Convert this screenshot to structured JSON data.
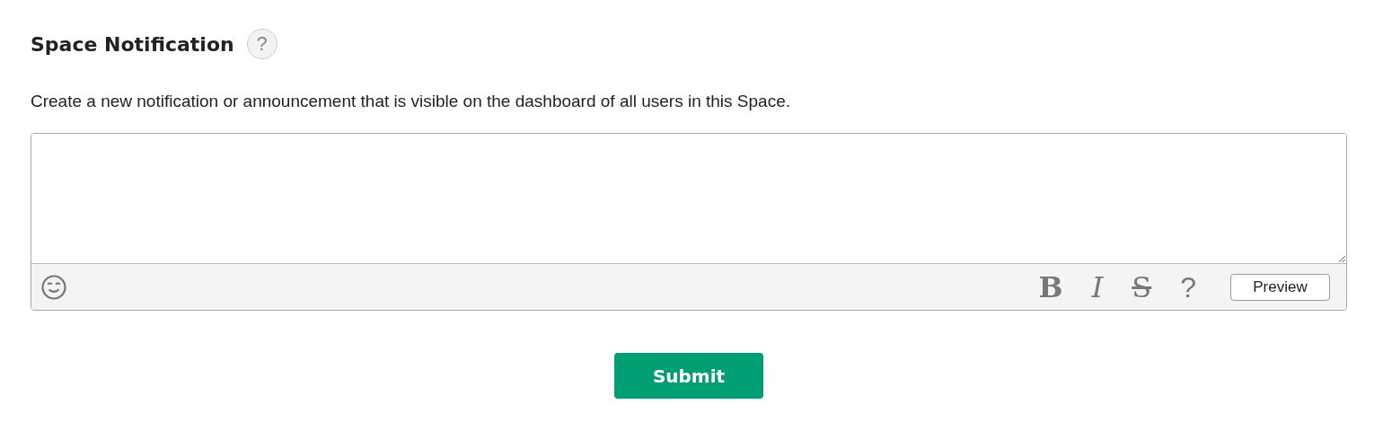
{
  "title": "Space Notification",
  "help_badge": "?",
  "description": "Create a new notification or announcement that is visible on the dashboard of all users in this Space.",
  "editor": {
    "format_buttons": [
      {
        "kind": "bold",
        "label": "B"
      },
      {
        "kind": "italic",
        "label": "I"
      },
      {
        "kind": "strike",
        "label": "S"
      },
      {
        "kind": "help",
        "label": "?"
      }
    ],
    "preview_button": "Preview"
  },
  "submit_button": "Submit"
}
